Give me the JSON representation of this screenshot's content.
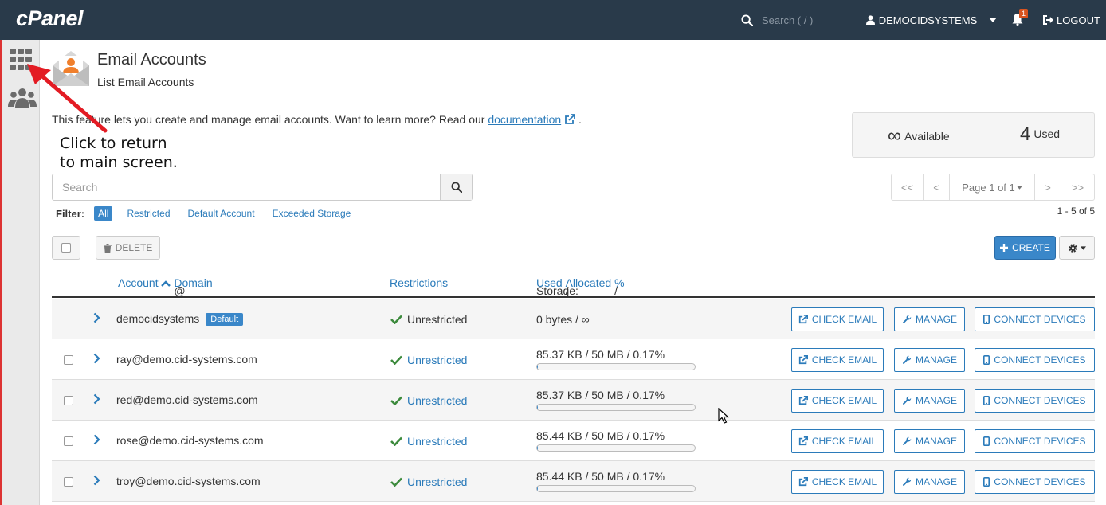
{
  "topbar": {
    "logo": "cPanel",
    "search_placeholder": "Search ( / )",
    "username": "DEMOCIDSYSTEMS",
    "notification_count": "1",
    "logout": "LOGOUT"
  },
  "sidebar": {
    "items": [
      {
        "icon": "grid-icon"
      },
      {
        "icon": "users-icon"
      }
    ]
  },
  "page": {
    "title": "Email Accounts",
    "subtitle": "List Email Accounts",
    "description": "This feature lets you create and manage email accounts. Want to learn more? Read our",
    "doc_link": "documentation",
    "desc_end": ".",
    "callout_line1": "Click to return",
    "callout_line2": "to main screen."
  },
  "stats": {
    "available_symbol": "∞",
    "available_label": "Available",
    "used_count": "4",
    "used_label": "Used"
  },
  "search": {
    "placeholder": "Search"
  },
  "pager": {
    "first": "<<",
    "prev": "<",
    "page": "Page 1 of 1",
    "next": ">",
    "last": ">>",
    "range": "1 - 5 of 5"
  },
  "filter": {
    "label": "Filter:",
    "options": [
      "All",
      "Restricted",
      "Default Account",
      "Exceeded Storage"
    ],
    "active": "All"
  },
  "toolbar": {
    "delete": "DELETE",
    "create": "CREATE"
  },
  "table": {
    "headers": {
      "account": "Account",
      "at": "@",
      "domain": "Domain",
      "restrictions": "Restrictions",
      "storage": "Storage:",
      "used": "Used",
      "sep": "/",
      "allocated": "Allocated",
      "pct": "%"
    },
    "buttons": {
      "check_email": "CHECK EMAIL",
      "manage": "MANAGE",
      "connect": "CONNECT DEVICES"
    },
    "rows": [
      {
        "account": "democidsystems",
        "badge": "Default",
        "restriction": "Unrestricted",
        "storage": "0 bytes / ∞",
        "usage": null
      },
      {
        "account": "ray@demo.cid-systems.com",
        "restriction": "Unrestricted",
        "storage": "85.37 KB / 50 MB / 0.17%",
        "usage": 0.0017
      },
      {
        "account": "red@demo.cid-systems.com",
        "restriction": "Unrestricted",
        "storage": "85.37 KB / 50 MB / 0.17%",
        "usage": 0.0017
      },
      {
        "account": "rose@demo.cid-systems.com",
        "restriction": "Unrestricted",
        "storage": "85.44 KB / 50 MB / 0.17%",
        "usage": 0.0017
      },
      {
        "account": "troy@demo.cid-systems.com",
        "restriction": "Unrestricted",
        "storage": "85.44 KB / 50 MB / 0.17%",
        "usage": 0.0017
      }
    ]
  },
  "colors": {
    "topbar": "#293a4a",
    "accent": "#3a87c9",
    "link": "#2b7bba",
    "check": "#3c8a3c",
    "arrow": "#e31b23"
  }
}
